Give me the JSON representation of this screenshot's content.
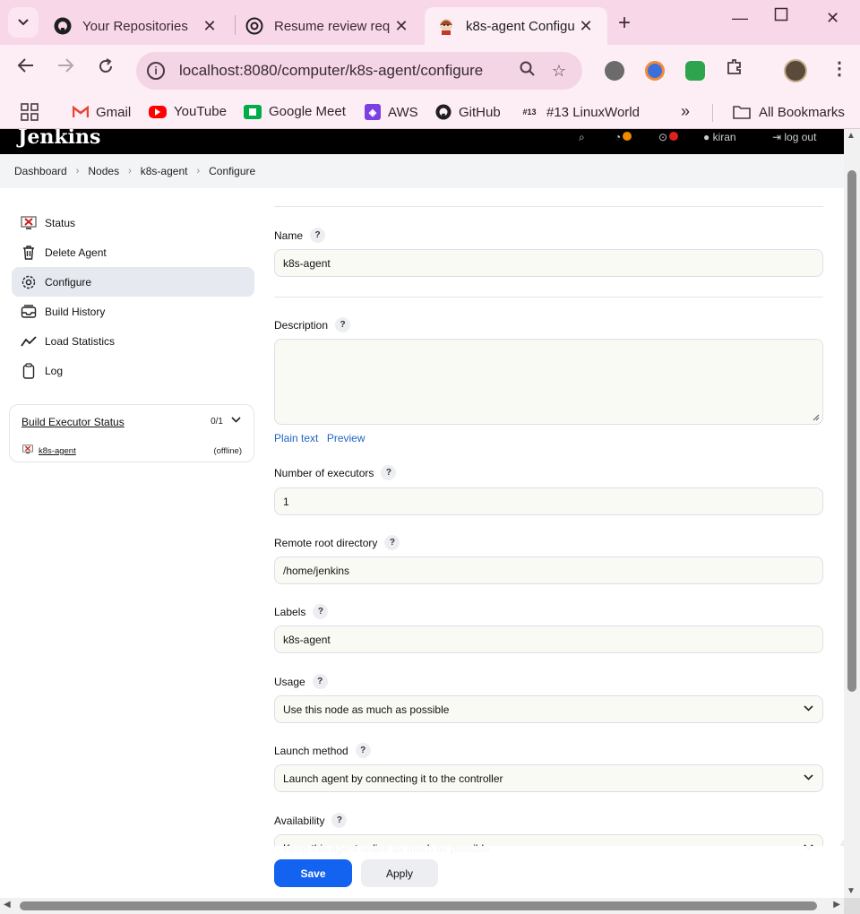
{
  "browser": {
    "tabs": [
      {
        "title": "Your Repositories",
        "icon": "github-icon",
        "active": false
      },
      {
        "title": "Resume review req",
        "icon": "chatgpt-icon",
        "active": false
      },
      {
        "title": "k8s-agent Configu",
        "icon": "jenkins-icon",
        "active": true
      }
    ],
    "new_tab_symbol": "+",
    "url": "localhost:8080/computer/k8s-agent/configure",
    "bookmarks": [
      {
        "label": "Gmail",
        "icon": "gmail-icon"
      },
      {
        "label": "YouTube",
        "icon": "youtube-icon"
      },
      {
        "label": "Google Meet",
        "icon": "google-meet-icon"
      },
      {
        "label": "AWS",
        "icon": "aws-icon"
      },
      {
        "label": "GitHub",
        "icon": "github-icon"
      },
      {
        "label": "#13 LinuxWorld",
        "icon": "linuxworld-icon",
        "badge": "#13"
      }
    ],
    "all_bookmarks": "All Bookmarks",
    "more_symbol": "»"
  },
  "jenkins": {
    "logo_text": "Jenkins",
    "header_user": "kiran",
    "header_logout": "log out",
    "breadcrumbs": [
      "Dashboard",
      "Nodes",
      "k8s-agent",
      "Configure"
    ],
    "sidebar": [
      {
        "label": "Status",
        "icon": "computer-offline-icon"
      },
      {
        "label": "Delete Agent",
        "icon": "trash-icon"
      },
      {
        "label": "Configure",
        "icon": "gear-icon",
        "active": true
      },
      {
        "label": "Build History",
        "icon": "inbox-icon"
      },
      {
        "label": "Load Statistics",
        "icon": "line-chart-icon"
      },
      {
        "label": "Log",
        "icon": "clipboard-icon"
      }
    ],
    "executor": {
      "title": "Build Executor Status",
      "count": "0/1",
      "agent": "k8s-agent",
      "status": "(offline)"
    },
    "form": {
      "name_label": "Name",
      "name_value": "k8s-agent",
      "description_label": "Description",
      "description_value": "",
      "plain_text": "Plain text",
      "preview": "Preview",
      "executors_label": "Number of executors",
      "executors_value": "1",
      "root_label": "Remote root directory",
      "root_value": "/home/jenkins",
      "labels_label": "Labels",
      "labels_value": "k8s-agent",
      "usage_label": "Usage",
      "usage_value": "Use this node as much as possible",
      "launch_label": "Launch method",
      "launch_value": "Launch agent by connecting it to the controller",
      "availability_label": "Availability",
      "availability_value": "Keep this agent online as much as possible",
      "help_symbol": "?"
    },
    "buttons": {
      "save": "Save",
      "apply": "Apply"
    }
  },
  "colors": {
    "save_button": "#1462f0",
    "tabstrip": "#f8d7e9",
    "header": "#000000",
    "link": "#2364c4"
  }
}
